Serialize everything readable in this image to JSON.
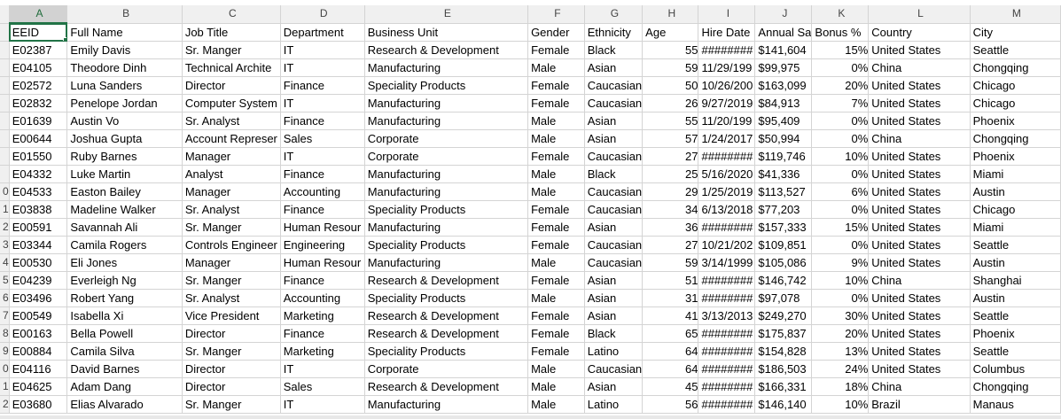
{
  "sheet": {
    "columns": [
      "A",
      "B",
      "C",
      "D",
      "E",
      "F",
      "G",
      "H",
      "I",
      "J",
      "K",
      "L",
      "M"
    ],
    "selected_column": "A",
    "active_cell": "A1",
    "row_labels": [
      "",
      "",
      "",
      "",
      "",
      "",
      "",
      "",
      "",
      "0",
      "1",
      "2",
      "3",
      "4",
      "5",
      "6",
      "7",
      "8",
      "9",
      "0",
      "1",
      "2"
    ],
    "headers": [
      "EEID",
      "Full Name",
      "Job Title",
      "Department",
      "Business Unit",
      "Gender",
      "Ethnicity",
      "Age",
      "Hire Date",
      "Annual Sa",
      "Bonus %",
      "Country",
      "City"
    ],
    "rows": [
      [
        "E02387",
        "Emily Davis",
        "Sr. Manger",
        "IT",
        "Research & Development",
        "Female",
        "Black",
        "55",
        "########",
        "$141,604",
        "15%",
        "United States",
        "Seattle"
      ],
      [
        "E04105",
        "Theodore Dinh",
        "Technical Archite",
        "IT",
        "Manufacturing",
        "Male",
        "Asian",
        "59",
        "11/29/199",
        "$99,975",
        "0%",
        "China",
        "Chongqing"
      ],
      [
        "E02572",
        "Luna Sanders",
        "Director",
        "Finance",
        "Speciality Products",
        "Female",
        "Caucasian",
        "50",
        "10/26/200",
        "$163,099",
        "20%",
        "United States",
        "Chicago"
      ],
      [
        "E02832",
        "Penelope Jordan",
        "Computer System",
        "IT",
        "Manufacturing",
        "Female",
        "Caucasian",
        "26",
        "9/27/2019",
        "$84,913",
        "7%",
        "United States",
        "Chicago"
      ],
      [
        "E01639",
        "Austin Vo",
        "Sr. Analyst",
        "Finance",
        "Manufacturing",
        "Male",
        "Asian",
        "55",
        "11/20/199",
        "$95,409",
        "0%",
        "United States",
        "Phoenix"
      ],
      [
        "E00644",
        "Joshua Gupta",
        "Account Represer",
        "Sales",
        "Corporate",
        "Male",
        "Asian",
        "57",
        "1/24/2017",
        "$50,994",
        "0%",
        "China",
        "Chongqing"
      ],
      [
        "E01550",
        "Ruby Barnes",
        "Manager",
        "IT",
        "Corporate",
        "Female",
        "Caucasian",
        "27",
        "########",
        "$119,746",
        "10%",
        "United States",
        "Phoenix"
      ],
      [
        "E04332",
        "Luke Martin",
        "Analyst",
        "Finance",
        "Manufacturing",
        "Male",
        "Black",
        "25",
        "5/16/2020",
        "$41,336",
        "0%",
        "United States",
        "Miami"
      ],
      [
        "E04533",
        "Easton Bailey",
        "Manager",
        "Accounting",
        "Manufacturing",
        "Male",
        "Caucasian",
        "29",
        "1/25/2019",
        "$113,527",
        "6%",
        "United States",
        "Austin"
      ],
      [
        "E03838",
        "Madeline Walker",
        "Sr. Analyst",
        "Finance",
        "Speciality Products",
        "Female",
        "Caucasian",
        "34",
        "6/13/2018",
        "$77,203",
        "0%",
        "United States",
        "Chicago"
      ],
      [
        "E00591",
        "Savannah Ali",
        "Sr. Manger",
        "Human Resour",
        "Manufacturing",
        "Female",
        "Asian",
        "36",
        "########",
        "$157,333",
        "15%",
        "United States",
        "Miami"
      ],
      [
        "E03344",
        "Camila Rogers",
        "Controls Engineer",
        "Engineering",
        "Speciality Products",
        "Female",
        "Caucasian",
        "27",
        "10/21/202",
        "$109,851",
        "0%",
        "United States",
        "Seattle"
      ],
      [
        "E00530",
        "Eli Jones",
        "Manager",
        "Human Resour",
        "Manufacturing",
        "Male",
        "Caucasian",
        "59",
        "3/14/1999",
        "$105,086",
        "9%",
        "United States",
        "Austin"
      ],
      [
        "E04239",
        "Everleigh Ng",
        "Sr. Manger",
        "Finance",
        "Research & Development",
        "Female",
        "Asian",
        "51",
        "########",
        "$146,742",
        "10%",
        "China",
        "Shanghai"
      ],
      [
        "E03496",
        "Robert Yang",
        "Sr. Analyst",
        "Accounting",
        "Speciality Products",
        "Male",
        "Asian",
        "31",
        "########",
        "$97,078",
        "0%",
        "United States",
        "Austin"
      ],
      [
        "E00549",
        "Isabella Xi",
        "Vice President",
        "Marketing",
        "Research & Development",
        "Female",
        "Asian",
        "41",
        "3/13/2013",
        "$249,270",
        "30%",
        "United States",
        "Seattle"
      ],
      [
        "E00163",
        "Bella Powell",
        "Director",
        "Finance",
        "Research & Development",
        "Female",
        "Black",
        "65",
        "########",
        "$175,837",
        "20%",
        "United States",
        "Phoenix"
      ],
      [
        "E00884",
        "Camila Silva",
        "Sr. Manger",
        "Marketing",
        "Speciality Products",
        "Female",
        "Latino",
        "64",
        "########",
        "$154,828",
        "13%",
        "United States",
        "Seattle"
      ],
      [
        "E04116",
        "David Barnes",
        "Director",
        "IT",
        "Corporate",
        "Male",
        "Caucasian",
        "64",
        "########",
        "$186,503",
        "24%",
        "United States",
        "Columbus"
      ],
      [
        "E04625",
        "Adam Dang",
        "Director",
        "Sales",
        "Research & Development",
        "Male",
        "Asian",
        "45",
        "########",
        "$166,331",
        "18%",
        "China",
        "Chongqing"
      ],
      [
        "E03680",
        "Elias Alvarado",
        "Sr. Manger",
        "IT",
        "Manufacturing",
        "Male",
        "Latino",
        "56",
        "########",
        "$146,140",
        "10%",
        "Brazil",
        "Manaus"
      ]
    ],
    "numeric_columns": [
      7,
      10
    ],
    "colors": {
      "selected_header_text": "#1e6b3a",
      "selection_border": "#217346",
      "header_bg": "#f0f0f0",
      "gridline": "#d4d4d4"
    }
  }
}
